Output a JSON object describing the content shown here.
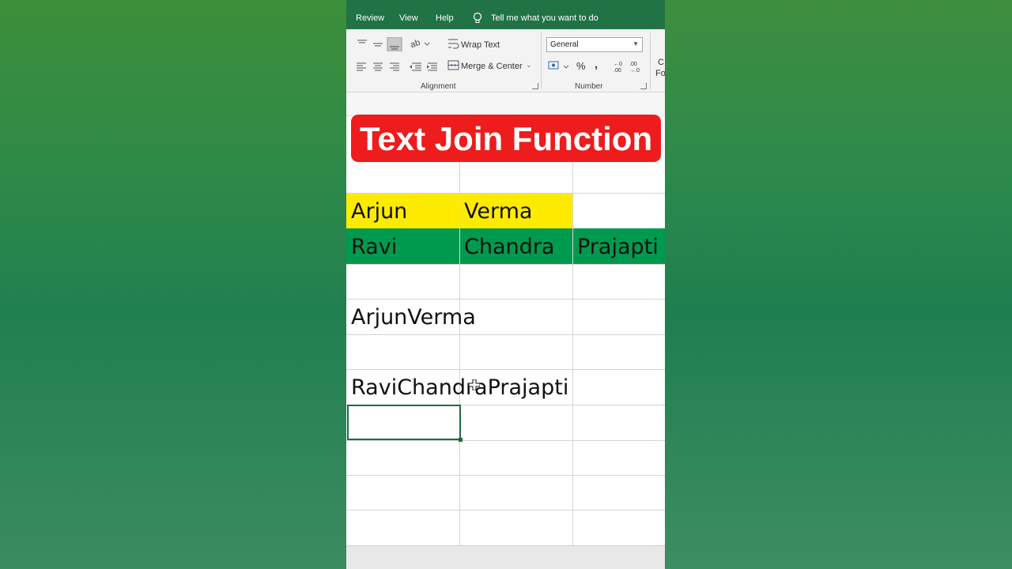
{
  "menu": {
    "tabs": [
      "Review",
      "View",
      "Help"
    ],
    "tell_me": "Tell me what you want to do"
  },
  "ribbon": {
    "wrap_text": "Wrap Text",
    "merge_center": "Merge & Center",
    "number_format": "General",
    "percent": "%",
    "comma": ",",
    "alignment_label": "Alignment",
    "number_label": "Number",
    "cut_off_1": "C",
    "cut_off_2": "Fo"
  },
  "banner": {
    "title": "Text Join Function"
  },
  "sheet": {
    "row1": {
      "a": "Arjun",
      "b": "Verma"
    },
    "row2": {
      "a": "Ravi",
      "b": "Chandra",
      "c": "Prajapti"
    },
    "result1": "ArjunVerma",
    "result2": "RaviChandraPrajapti"
  },
  "colors": {
    "menubar": "#217346",
    "banner": "#ee1c1c",
    "highlight_yellow": "#ffeb00",
    "highlight_green": "#009a4e",
    "selection": "#1d6b3e"
  }
}
